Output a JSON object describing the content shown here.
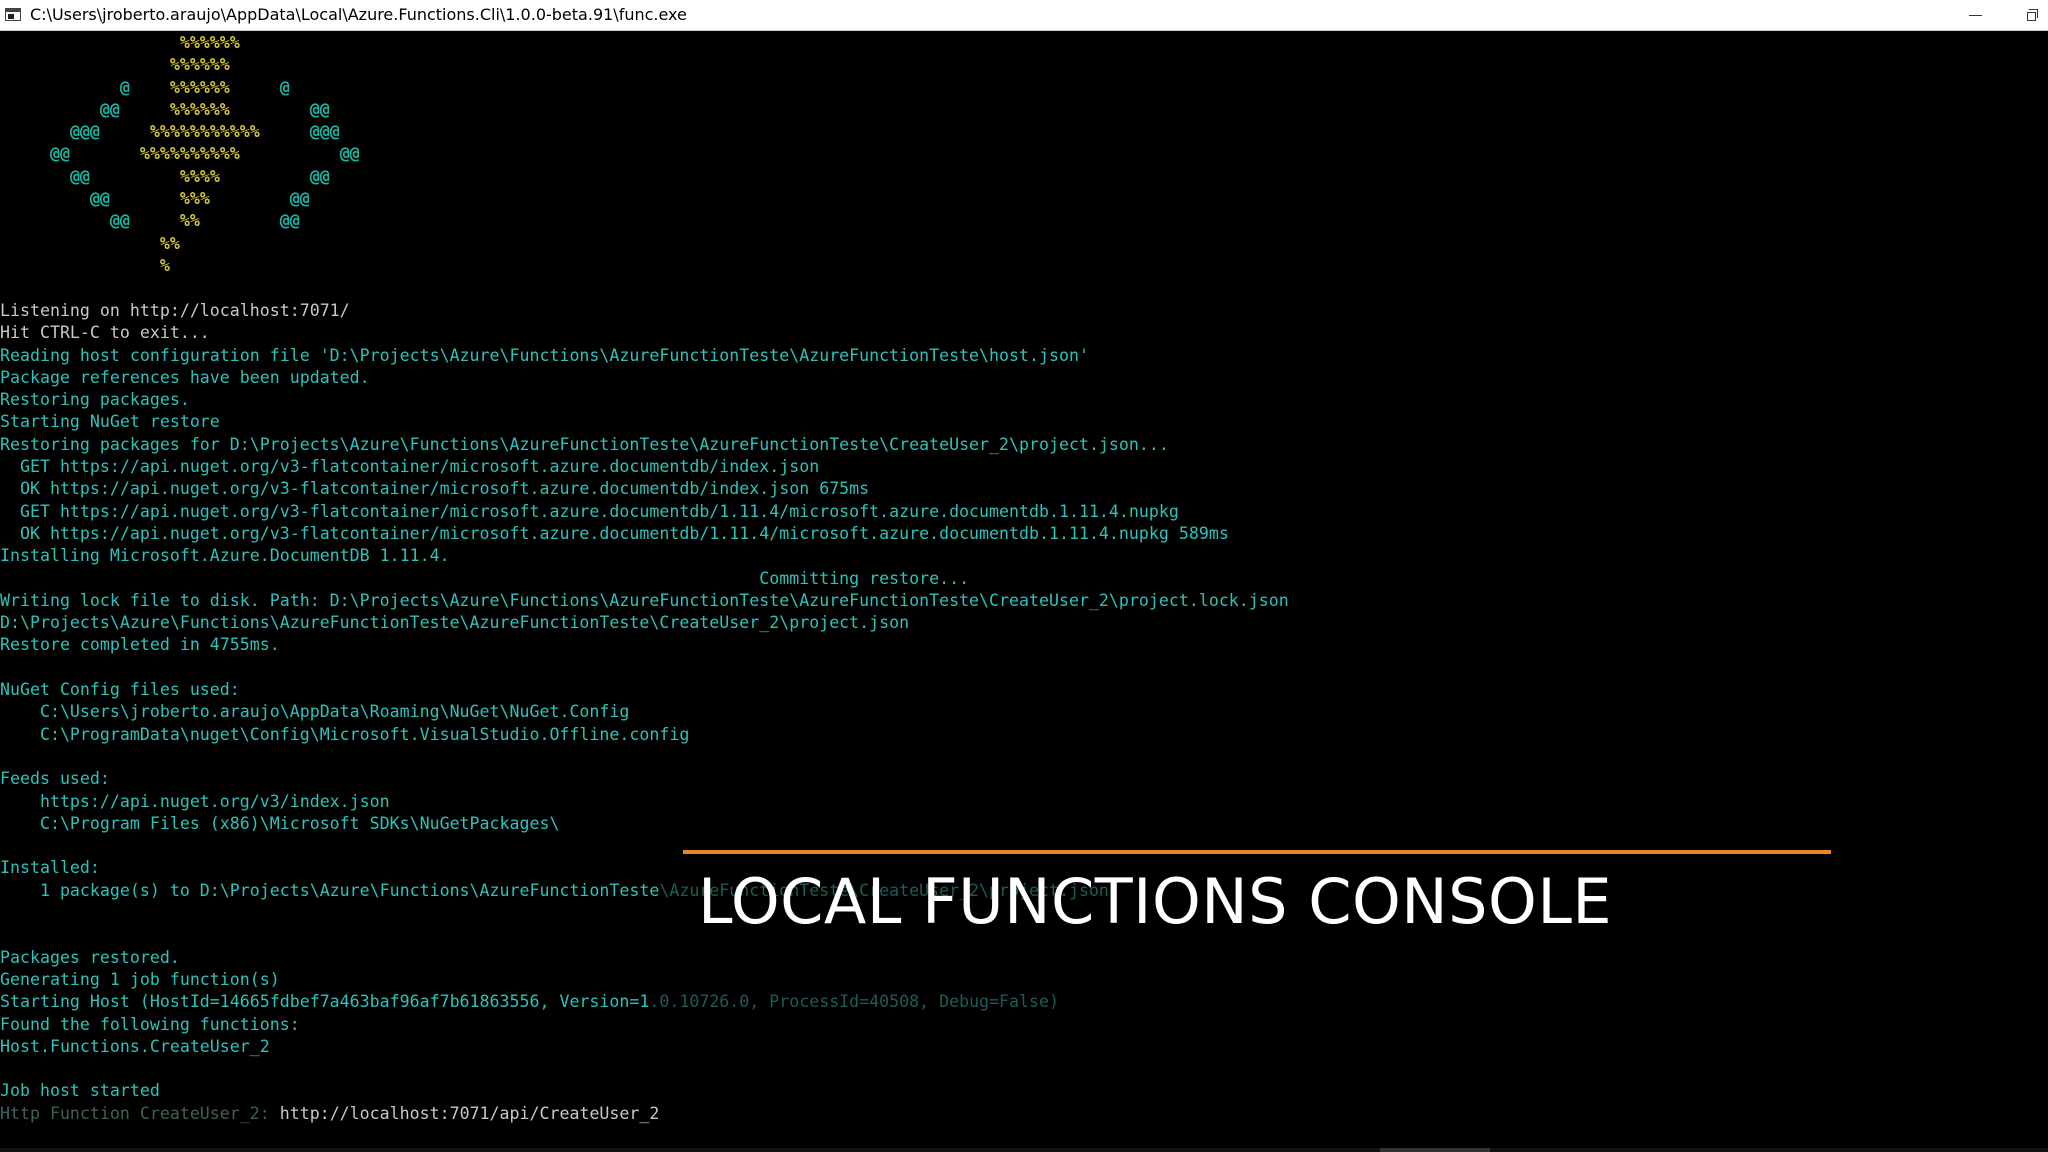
{
  "window": {
    "title": "C:\\Users\\jroberto.araujo\\AppData\\Local\\Azure.Functions.Cli\\1.0.0-beta.91\\func.exe",
    "minimize_icon": "minimize-icon",
    "maximize_icon": "restore-icon"
  },
  "ascii_logo": [
    {
      "at_l": "",
      "pc": "%%%%%%",
      "at_r": ""
    },
    {
      "at_l": "",
      "pc": "%%%%%%",
      "at_r": ""
    },
    {
      "at_l": "@",
      "pc": "%%%%%%",
      "at_r": "@"
    },
    {
      "at_l": "@@",
      "pc": "%%%%%%",
      "at_r": "@@"
    },
    {
      "at_l": "@@@",
      "pc": "%%%%%%%%%%%",
      "at_r": "@@@"
    },
    {
      "at_l": "@@",
      "pc": "%%%%%%%%%%",
      "at_r": "@@"
    },
    {
      "at_l": "@@",
      "pc": "%%%%",
      "at_r": "@@"
    },
    {
      "at_l": "@@",
      "pc": "%%%",
      "at_r": "@@"
    },
    {
      "at_l": "@@",
      "pc": "%%",
      "at_r": "@@"
    },
    {
      "at_l": "",
      "pc": "%%",
      "at_r": ""
    },
    {
      "at_l": "",
      "pc": "%",
      "at_r": ""
    }
  ],
  "console": {
    "listening": "Listening on http://localhost:7071/",
    "hit_ctrl_c": "Hit CTRL-C to exit...",
    "reading_host": "Reading host configuration file 'D:\\Projects\\Azure\\Functions\\AzureFunctionTeste\\AzureFunctionTeste\\host.json'",
    "pkg_updated": "Package references have been updated.",
    "restoring": "Restoring packages.",
    "starting_nuget": "Starting NuGet restore",
    "restoring_for": "Restoring packages for D:\\Projects\\Azure\\Functions\\AzureFunctionTeste\\AzureFunctionTeste\\CreateUser_2\\project.json...",
    "get1": "  GET https://api.nuget.org/v3-flatcontainer/microsoft.azure.documentdb/index.json",
    "ok1": "  OK https://api.nuget.org/v3-flatcontainer/microsoft.azure.documentdb/index.json 675ms",
    "get2": "  GET https://api.nuget.org/v3-flatcontainer/microsoft.azure.documentdb/1.11.4/microsoft.azure.documentdb.1.11.4.nupkg",
    "ok2": "  OK https://api.nuget.org/v3-flatcontainer/microsoft.azure.documentdb/1.11.4/microsoft.azure.documentdb.1.11.4.nupkg 589ms",
    "installing": "Installing Microsoft.Azure.DocumentDB 1.11.4.",
    "committing": "                                                                            Committing restore...",
    "writing_lock": "Writing lock file to disk. Path: D:\\Projects\\Azure\\Functions\\AzureFunctionTeste\\AzureFunctionTeste\\CreateUser_2\\project.lock.json",
    "project_json": "D:\\Projects\\Azure\\Functions\\AzureFunctionTeste\\AzureFunctionTeste\\CreateUser_2\\project.json",
    "restore_completed": "Restore completed in 4755ms.",
    "nuget_config_used": "NuGet Config files used:",
    "config1": "    C:\\Users\\jroberto.araujo\\AppData\\Roaming\\NuGet\\NuGet.Config",
    "config2": "    C:\\ProgramData\\nuget\\Config\\Microsoft.VisualStudio.Offline.config",
    "feeds_used": "Feeds used:",
    "feed1": "    https://api.nuget.org/v3/index.json",
    "feed2": "    C:\\Program Files (x86)\\Microsoft SDKs\\NuGetPackages\\",
    "installed": "Installed:",
    "installed_line_a": "    1 package(s) to D:\\Projects\\Azure\\Functions\\AzureFunctionTeste",
    "installed_line_b": "\\AzureFunctionTeste\\CreateUser_2\\project.json",
    "packages_restored": "Packages restored.",
    "generating": "Generating 1 job function(s)",
    "starting_host_a": "Starting Host (HostId=14665fdbef7a463baf96af7b61863556, Version=1",
    "starting_host_b": ".0.10726.0, ProcessId=40508, Debug=False)",
    "found_functions": "Found the following functions:",
    "function_name": "Host.Functions.CreateUser_2",
    "job_host_started": "Job host started",
    "http_function_label": "Http Function CreateUser_2:",
    "http_function_url": " http://localhost:7071/api/CreateUser_2"
  },
  "overlay": {
    "title": "LOCAL FUNCTIONS CONSOLE",
    "rule_color": "#e8872a"
  },
  "colors": {
    "background": "#000000",
    "cyan_text": "#2ec2ba",
    "white_text": "#c8c8c8",
    "ascii_at": "#1ab5a4",
    "ascii_percent": "#d4c43a"
  }
}
